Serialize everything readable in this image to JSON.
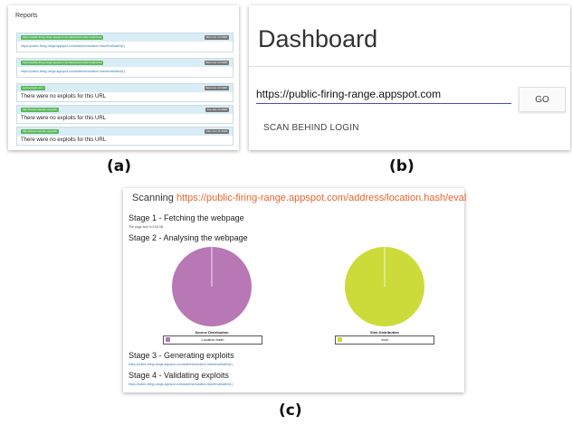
{
  "captions": {
    "a": "(a)",
    "b": "(b)",
    "c": "(c)"
  },
  "panel_a": {
    "title": "Reports",
    "reports": [
      {
        "url": "https://public-firing-range.appspot.com/address/location.hash/eval",
        "date": "Wed Jun 13 2018",
        "body": "https://public-firing-range.appspot.com/address/location.hash/eval#alert(1)",
        "type": "link"
      },
      {
        "url": "https://public-firing-range.appspot.com/address/location.hash/eval",
        "date": "Wed Jun 13 2018",
        "body": "https://public-firing-range.appspot.com/address/location.hash/eval#alert(1)",
        "type": "link"
      },
      {
        "url": "www.google.com",
        "date": "Wed Jun 13 2018",
        "body": "There were no exploits for this URL",
        "type": "msg"
      },
      {
        "url": "http://www.example.org/path",
        "date": "Tue Jun 12 2018",
        "body": "There were no exploits for this URL",
        "type": "msg"
      },
      {
        "url": "http://www.example.org/path",
        "date": "Mon Jun 11 2018",
        "body": "There were no exploits for this URL",
        "type": "msg"
      }
    ]
  },
  "panel_b": {
    "title": "Dashboard",
    "url_value": "https://public-firing-range.appspot.com",
    "go_label": "GO",
    "scan_behind_login": "SCAN BEHIND LOGIN",
    "accent": "#3f51b5"
  },
  "panel_c": {
    "scanning_label": "Scanning",
    "scanning_url": "https://public-firing-range.appspot.com/address/location.hash/eval",
    "stage1": "Stage 1 - Fetching the webpage",
    "stage1_detail": "The page size is 6.54 kB",
    "stage2": "Stage 2 - Analysing the webpage",
    "source_chart": {
      "caption": "Source Distribution",
      "legend": "Location.hash",
      "color": "#b877b5"
    },
    "sink_chart": {
      "caption": "Sink Distribution",
      "legend": "eval",
      "color": "#cddb3a"
    },
    "stage3": "Stage 3 - Generating exploits",
    "stage3_link": "https://public-firing-range.appspot.com/address/location.hash/eval#alert(1)",
    "stage4": "Stage 4 - Validating exploits",
    "stage4_link": "https://public-firing-range.appspot.com/address/location.hash/eval#alert(1)"
  }
}
